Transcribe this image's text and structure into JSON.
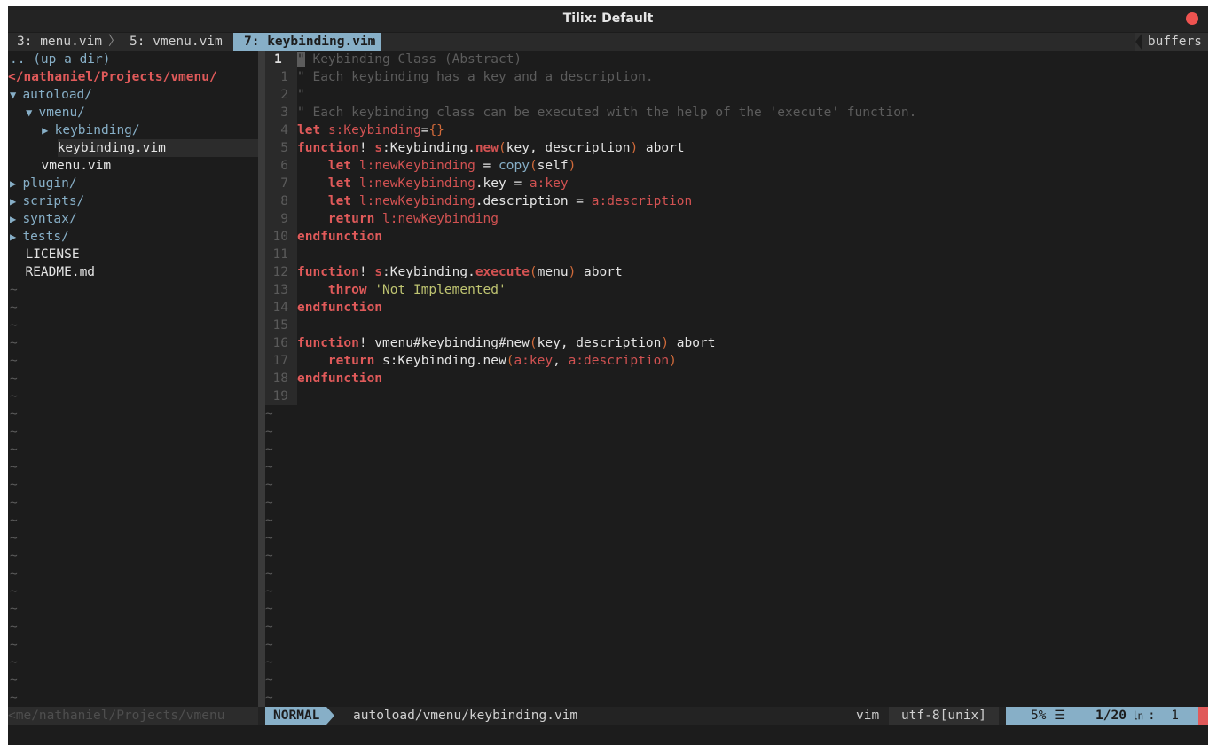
{
  "window": {
    "title": "Tilix: Default"
  },
  "tabline": {
    "tabs": [
      "3: menu.vim",
      "5: vmenu.vim",
      "7: keybinding.vim"
    ],
    "active_index": 2,
    "right_label": "buffers"
  },
  "tree": {
    "up": ".. (up a dir)",
    "root": "</nathaniel/Projects/vmenu/",
    "items": [
      {
        "arrow": "▼",
        "name": "autoload/",
        "depth": 0,
        "dir": true
      },
      {
        "arrow": "▼",
        "name": "vmenu/",
        "depth": 1,
        "dir": true
      },
      {
        "arrow": "▶",
        "name": "keybinding/",
        "depth": 2,
        "dir": true
      },
      {
        "arrow": "",
        "name": "keybinding.vim",
        "depth": 2,
        "dir": false
      },
      {
        "arrow": "",
        "name": "vmenu.vim",
        "depth": 1,
        "dir": false
      },
      {
        "arrow": "▶",
        "name": "plugin/",
        "depth": 0,
        "dir": true
      },
      {
        "arrow": "▶",
        "name": "scripts/",
        "depth": 0,
        "dir": true
      },
      {
        "arrow": "▶",
        "name": "syntax/",
        "depth": 0,
        "dir": true
      },
      {
        "arrow": "▶",
        "name": "tests/",
        "depth": 0,
        "dir": true
      },
      {
        "arrow": "",
        "name": "LICENSE",
        "depth": 0,
        "dir": false
      },
      {
        "arrow": "",
        "name": "README.md",
        "depth": 0,
        "dir": false
      }
    ],
    "tilde": "~"
  },
  "editor": {
    "current_line": "1",
    "line_numbers": [
      "1",
      "1",
      "2",
      "3",
      "4",
      "5",
      "6",
      "7",
      "8",
      "9",
      "10",
      "11",
      "12",
      "13",
      "14",
      "15",
      "16",
      "17",
      "18",
      "19"
    ],
    "lines": [
      [
        [
          "c-comment",
          "\" Keybinding Class (Abstract)"
        ]
      ],
      [
        [
          "c-comment",
          "\" Each keybinding has a key and a description."
        ]
      ],
      [
        [
          "c-comment",
          "\""
        ]
      ],
      [
        [
          "c-comment",
          "\" Each keybinding class can be executed with the help of the 'execute' function."
        ]
      ],
      [
        [
          "c-kw",
          "let"
        ],
        [
          "c-plain",
          " "
        ],
        [
          "c-var",
          "s:Keybinding"
        ],
        [
          "c-plain",
          "="
        ],
        [
          "c-paren",
          "{}"
        ]
      ],
      [
        [
          "c-kw",
          "function"
        ],
        [
          "c-plain",
          "! "
        ],
        [
          "c-func",
          "s"
        ],
        [
          "c-plain",
          ":Keybinding."
        ],
        [
          "c-func",
          "new"
        ],
        [
          "c-paren",
          "("
        ],
        [
          "c-plain",
          "key, description"
        ],
        [
          "c-paren",
          ")"
        ],
        [
          "c-plain",
          " abort"
        ]
      ],
      [
        [
          "c-plain",
          "    "
        ],
        [
          "c-kw",
          "let"
        ],
        [
          "c-plain",
          " "
        ],
        [
          "c-var",
          "l:newKeybinding"
        ],
        [
          "c-plain",
          " = "
        ],
        [
          "c-call",
          "copy"
        ],
        [
          "c-paren",
          "("
        ],
        [
          "c-plain",
          "self"
        ],
        [
          "c-paren",
          ")"
        ]
      ],
      [
        [
          "c-plain",
          "    "
        ],
        [
          "c-kw",
          "let"
        ],
        [
          "c-plain",
          " "
        ],
        [
          "c-var",
          "l:newKeybinding"
        ],
        [
          "c-plain",
          ".key = "
        ],
        [
          "c-var",
          "a:key"
        ]
      ],
      [
        [
          "c-plain",
          "    "
        ],
        [
          "c-kw",
          "let"
        ],
        [
          "c-plain",
          " "
        ],
        [
          "c-var",
          "l:newKeybinding"
        ],
        [
          "c-plain",
          ".description = "
        ],
        [
          "c-var",
          "a:description"
        ]
      ],
      [
        [
          "c-plain",
          "    "
        ],
        [
          "c-kw",
          "return"
        ],
        [
          "c-plain",
          " "
        ],
        [
          "c-var",
          "l:newKeybinding"
        ]
      ],
      [
        [
          "c-kw",
          "endfunction"
        ]
      ],
      [],
      [
        [
          "c-kw",
          "function"
        ],
        [
          "c-plain",
          "! "
        ],
        [
          "c-func",
          "s"
        ],
        [
          "c-plain",
          ":Keybinding."
        ],
        [
          "c-func",
          "execute"
        ],
        [
          "c-paren",
          "("
        ],
        [
          "c-plain",
          "menu"
        ],
        [
          "c-paren",
          ")"
        ],
        [
          "c-plain",
          " abort"
        ]
      ],
      [
        [
          "c-plain",
          "    "
        ],
        [
          "c-kw",
          "throw"
        ],
        [
          "c-plain",
          " "
        ],
        [
          "c-str",
          "'Not Implemented'"
        ]
      ],
      [
        [
          "c-kw",
          "endfunction"
        ]
      ],
      [],
      [
        [
          "c-kw",
          "function"
        ],
        [
          "c-plain",
          "! vmenu#keybinding#new"
        ],
        [
          "c-paren",
          "("
        ],
        [
          "c-plain",
          "key, description"
        ],
        [
          "c-paren",
          ")"
        ],
        [
          "c-plain",
          " abort"
        ]
      ],
      [
        [
          "c-plain",
          "    "
        ],
        [
          "c-kw",
          "return"
        ],
        [
          "c-plain",
          " s:Keybinding.new"
        ],
        [
          "c-paren",
          "("
        ],
        [
          "c-var",
          "a:key"
        ],
        [
          "c-plain",
          ", "
        ],
        [
          "c-var",
          "a:description"
        ],
        [
          "c-paren",
          ")"
        ]
      ],
      [
        [
          "c-kw",
          "endfunction"
        ]
      ],
      []
    ]
  },
  "statusline": {
    "left_path": "<me/nathaniel/Projects/vmenu",
    "mode": "NORMAL",
    "file": "autoload/vmenu/keybinding.vim",
    "filetype": "vim",
    "encoding": "utf-8[unix]",
    "percent": "5% ☰",
    "position": "1/20",
    "ln_symbol": "㏑",
    "column": ":  1"
  },
  "colors": {
    "accent": "#87afc7",
    "keyword": "#e05a5a",
    "string": "#bfc471",
    "comment": "#5c5c5c",
    "close_button": "#ef5350"
  }
}
